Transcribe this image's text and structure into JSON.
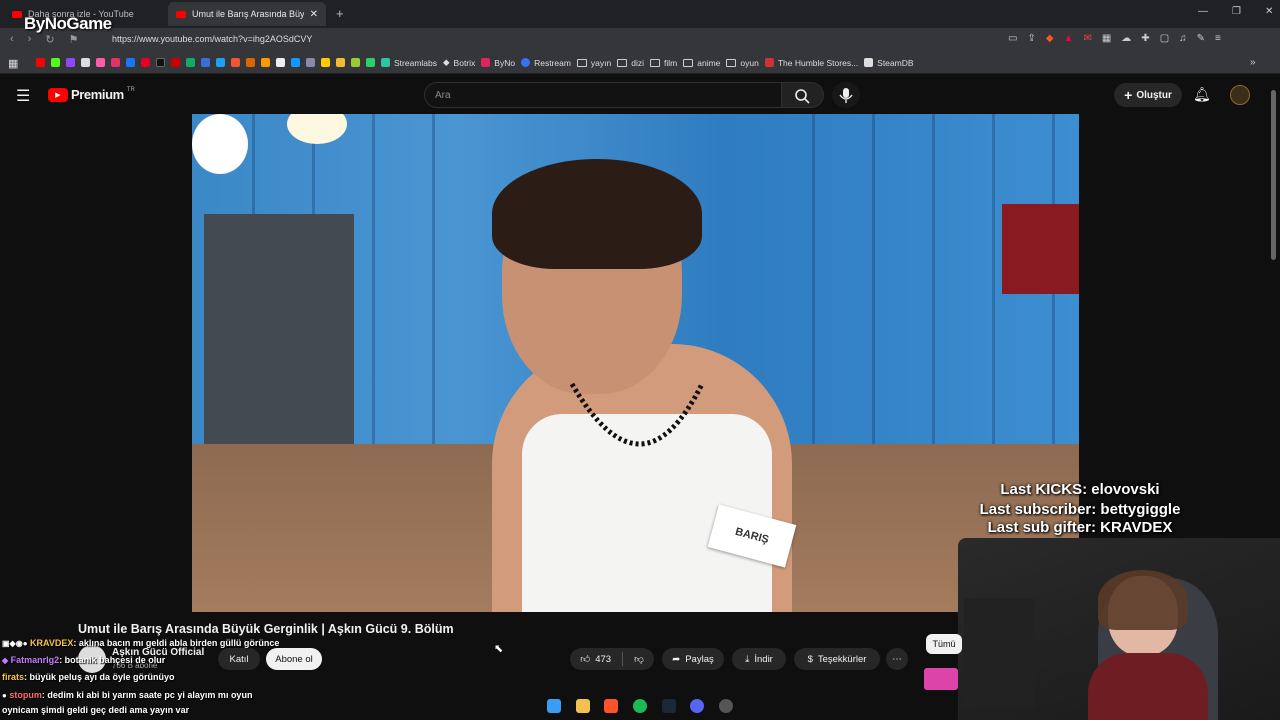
{
  "browser": {
    "tabs": [
      {
        "label": "Daha sonra izle - YouTube"
      },
      {
        "label": "Umut ile Barış Arasında Büyük G..."
      }
    ],
    "url": "https://www.youtube.com/watch?v=ihg2AOSdCVY",
    "bookmarks": [
      "Streamlabs",
      "Botrix",
      "ByNo",
      "Restream",
      "yayın",
      "dizi",
      "film",
      "anime",
      "oyun",
      "The Humble Stores...",
      "SteamDB"
    ]
  },
  "overlay_logo": "ByNoGame",
  "youtube": {
    "logo": "Premium",
    "logo_region": "TR",
    "search_placeholder": "Ara",
    "create_label": "Oluştur"
  },
  "video": {
    "name_badge": "BARIŞ",
    "title": "Umut ile Barış Arasında Büyük Gerginlik | Aşkın Gücü 9. Bölüm",
    "channel": "Aşkın Gücü Official",
    "subscribers": "786 B abone",
    "join_label": "Katıl",
    "subscribe_label": "Abone ol",
    "likes": "473",
    "share_label": "Paylaş",
    "download_label": "İndir",
    "thanks_label": "Teşekkürler",
    "all_label": "Tümü"
  },
  "stream_overlay": {
    "last_kicks": "Last KICKS: elovovski",
    "last_subscriber": "Last subscriber: bettygiggle",
    "last_sub_gifter": "Last sub gifter: KRAVDEX"
  },
  "chat": [
    {
      "user": "KRAVDEX",
      "text": ": aklına bacın mı geldi abla birden güllü görünce",
      "color": "#f5c542"
    },
    {
      "user": "Fatmanrlg2",
      "text": ": botanik bahçesi de olur",
      "color": "#c57bff"
    },
    {
      "user": "firats",
      "text": ": büyük peluş ayı da öyle görünüyo",
      "color": "#f5c542"
    },
    {
      "user": "stopum",
      "text": ": dedim ki abi bi yarım saate pc yi alayım mı oyun",
      "color": "#ff6b6b"
    },
    {
      "user": "",
      "text": "oynicam şimdi geldi geç dedi ama yayın var",
      "color": "#ffffff"
    }
  ]
}
